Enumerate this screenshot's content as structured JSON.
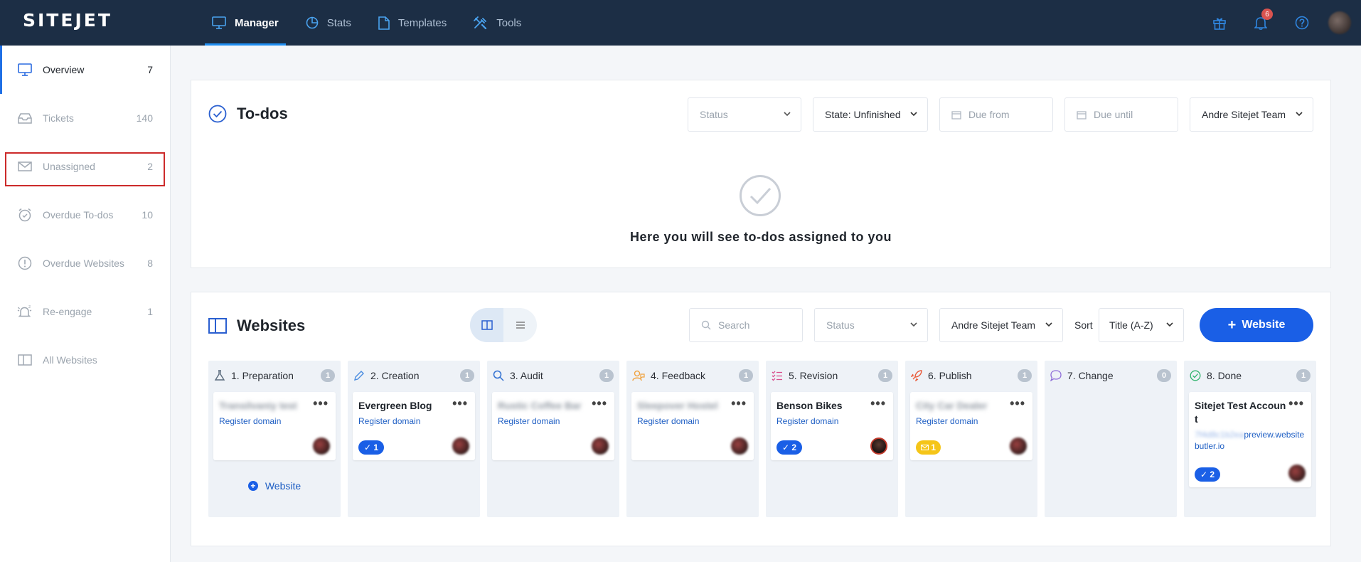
{
  "app": {
    "logo": "SITEJET"
  },
  "nav": [
    {
      "label": "Manager",
      "icon": "monitor-icon",
      "active": true
    },
    {
      "label": "Stats",
      "icon": "pie-chart-icon"
    },
    {
      "label": "Templates",
      "icon": "document-icon"
    },
    {
      "label": "Tools",
      "icon": "tools-icon"
    }
  ],
  "top_icons": {
    "notifications_count": "6"
  },
  "sidebar": {
    "items": [
      {
        "label": "Overview",
        "count": "7",
        "icon": "monitor-icon"
      },
      {
        "label": "Tickets",
        "count": "140",
        "icon": "inbox-icon"
      },
      {
        "label": "Unassigned",
        "count": "2",
        "icon": "envelope-icon"
      },
      {
        "label": "Overdue To-dos",
        "count": "10",
        "icon": "alarm-clock-icon"
      },
      {
        "label": "Overdue Websites",
        "count": "8",
        "icon": "alert-circle-icon"
      },
      {
        "label": "Re-engage",
        "count": "1",
        "icon": "alarm-bell-icon"
      },
      {
        "label": "All Websites",
        "count": "",
        "icon": "columns-icon"
      }
    ]
  },
  "todos": {
    "title": "To-dos",
    "filters": {
      "status": "Status",
      "state": "State: Unfinished",
      "due_from": "Due from",
      "due_until": "Due until",
      "team": "Andre Sitejet Team"
    },
    "empty_text": "Here you will see to-dos assigned to you"
  },
  "websites": {
    "title": "Websites",
    "search_placeholder": "Search",
    "status": "Status",
    "team": "Andre Sitejet Team",
    "sort_label": "Sort",
    "sort_value": "Title (A-Z)",
    "add_button": "Website",
    "add_in_column": "Website",
    "columns": [
      {
        "name": "1. Preparation",
        "count": "1",
        "icon_color": "#5a6b7d"
      },
      {
        "name": "2. Creation",
        "count": "1",
        "icon_color": "#4b8de0"
      },
      {
        "name": "3. Audit",
        "count": "1",
        "icon_color": "#2f6fd1"
      },
      {
        "name": "4. Feedback",
        "count": "1",
        "icon_color": "#f0a340"
      },
      {
        "name": "5. Revision",
        "count": "1",
        "icon_color": "#d94d8c"
      },
      {
        "name": "6. Publish",
        "count": "1",
        "icon_color": "#ea5a3a"
      },
      {
        "name": "7. Change",
        "count": "0",
        "icon_color": "#8f6fd9"
      },
      {
        "name": "8. Done",
        "count": "1",
        "icon_color": "#2fb36c"
      }
    ],
    "cards": {
      "c1": {
        "title": "Transilvaniy test",
        "link": "Register domain"
      },
      "c2": {
        "title": "Evergreen Blog",
        "link": "Register domain",
        "todos": "1"
      },
      "c3": {
        "title": "Rustic Coffee Bar",
        "link": "Register domain"
      },
      "c4": {
        "title": "Sleepover Hostel",
        "link": "Register domain"
      },
      "c5": {
        "title": "Benson Bikes",
        "link": "Register domain",
        "todos": "2"
      },
      "c6": {
        "title": "City Car Dealer",
        "link": "Register domain",
        "messages": "1"
      },
      "c8": {
        "title": "Sitejet Test Account",
        "url_blur": "7f4d8c1b2ea",
        "url": "preview.websitebutler.io",
        "todos": "2"
      }
    }
  },
  "colors": {
    "topbar": "#1c2e45",
    "primary": "#1a5fe6",
    "highlight": "#cc2a2a"
  }
}
